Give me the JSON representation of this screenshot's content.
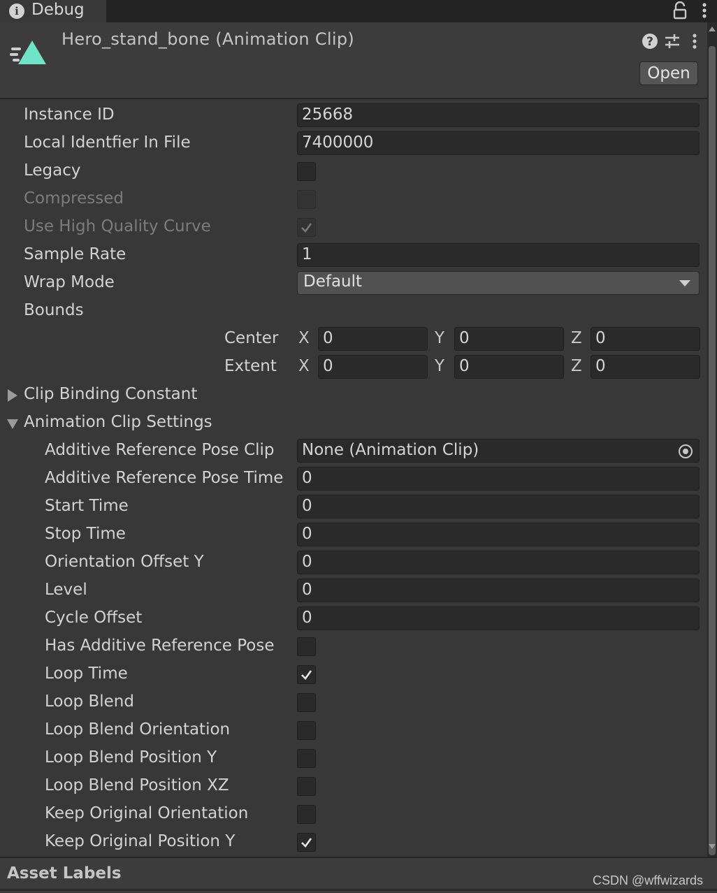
{
  "tab": {
    "label": "Debug",
    "icon": "info-icon"
  },
  "header": {
    "title": "Hero_stand_bone (Animation Clip)",
    "open_label": "Open",
    "icons": [
      "animation-clip-icon",
      "help-icon",
      "preset-icon",
      "context-menu-icon"
    ]
  },
  "fields": {
    "instance_id": {
      "label": "Instance ID",
      "value": "25668"
    },
    "local_identifier": {
      "label": "Local Identfier In File",
      "value": "7400000"
    },
    "legacy": {
      "label": "Legacy",
      "checked": false
    },
    "compressed": {
      "label": "Compressed",
      "checked": false,
      "disabled": true
    },
    "use_hq_curve": {
      "label": "Use High Quality Curve",
      "checked": true,
      "disabled": true
    },
    "sample_rate": {
      "label": "Sample Rate",
      "value": "1"
    },
    "wrap_mode": {
      "label": "Wrap Mode",
      "value": "Default"
    },
    "bounds": {
      "label": "Bounds",
      "center": {
        "label": "Center",
        "x": "0",
        "y": "0",
        "z": "0"
      },
      "extent": {
        "label": "Extent",
        "x": "0",
        "y": "0",
        "z": "0"
      },
      "axis_x": "X",
      "axis_y": "Y",
      "axis_z": "Z"
    }
  },
  "clip_binding": {
    "label": "Clip Binding Constant",
    "expanded": false
  },
  "clip_settings": {
    "label": "Animation Clip Settings",
    "expanded": true,
    "additive_ref_clip": {
      "label": "Additive Reference Pose Clip",
      "value": "None (Animation Clip)"
    },
    "additive_ref_time": {
      "label": "Additive Reference Pose Time",
      "value": "0"
    },
    "start_time": {
      "label": "Start Time",
      "value": "0"
    },
    "stop_time": {
      "label": "Stop Time",
      "value": "0"
    },
    "orientation_offset_y": {
      "label": "Orientation Offset Y",
      "value": "0"
    },
    "level": {
      "label": "Level",
      "value": "0"
    },
    "cycle_offset": {
      "label": "Cycle Offset",
      "value": "0"
    },
    "has_additive": {
      "label": "Has Additive Reference Pose",
      "checked": false
    },
    "loop_time": {
      "label": "Loop Time",
      "checked": true
    },
    "loop_blend": {
      "label": "Loop Blend",
      "checked": false
    },
    "loop_blend_orientation": {
      "label": "Loop Blend Orientation",
      "checked": false
    },
    "loop_blend_pos_y": {
      "label": "Loop Blend Position Y",
      "checked": false
    },
    "loop_blend_pos_xz": {
      "label": "Loop Blend Position XZ",
      "checked": false
    },
    "keep_orig_orientation": {
      "label": "Keep Original Orientation",
      "checked": false
    },
    "keep_orig_pos_y": {
      "label": "Keep Original Position Y",
      "checked": true
    }
  },
  "footer": {
    "title": "Asset Labels",
    "watermark": "CSDN @wffwizards"
  },
  "colors": {
    "background": "#383838",
    "field": "#2a2a2a",
    "accent_icon": "#6fe3c8"
  }
}
